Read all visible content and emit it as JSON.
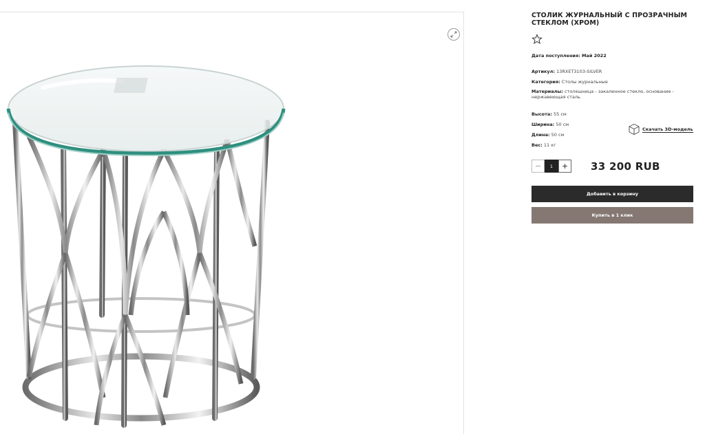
{
  "product": {
    "title": "СТОЛИК ЖУРНАЛЬНЫЙ С ПРОЗРАЧНЫМ СТЕКЛОМ (ХРОМ)",
    "arrival_label": "Дата поступления:",
    "arrival_value": "Май 2022",
    "sku_label": "Артикул:",
    "sku_value": "13RXET3103-SILVER",
    "category_label": "Категория:",
    "category_value": "Столы журнальные",
    "materials_label": "Материалы:",
    "materials_value": "столешница - закаленное стекло, основание - нержавеющая сталь",
    "height_label": "Высота:",
    "height_value": "55 см",
    "width_label": "Ширина:",
    "width_value": "50 см",
    "length_label": "Длина:",
    "length_value": "50 см",
    "weight_label": "Вес:",
    "weight_value": "11 кг",
    "download_3d_label": "Скачать 3D-модель",
    "price": "33 200 RUB"
  },
  "quantity": {
    "minus": "−",
    "value": "1",
    "plus": "+"
  },
  "buttons": {
    "add_to_cart": "Добавить в корзину",
    "buy_one_click": "Купить в 1 клик"
  },
  "icons": {
    "zoom": "expand-icon",
    "favorite": "star-icon",
    "download_3d": "cube-icon"
  },
  "colors": {
    "cart_button": "#2b2b2b",
    "oneclick_button": "#857873",
    "qty_input": "#222222"
  }
}
